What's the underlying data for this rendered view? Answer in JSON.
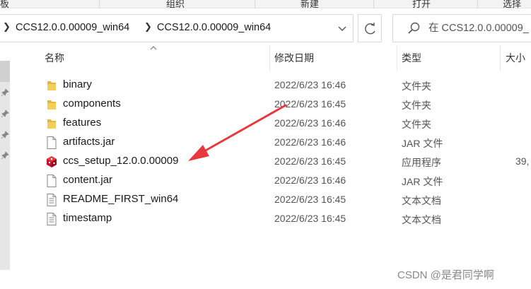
{
  "ribbon": {
    "items": [
      "板",
      "组织",
      "新建",
      "打开",
      "选择"
    ]
  },
  "address": {
    "crumbs": [
      "CCS12.0.0.00009_win64",
      "CCS12.0.0.00009_win64"
    ]
  },
  "search": {
    "placeholder": "在 CCS12.0.0.00009_"
  },
  "columns": {
    "name": "名称",
    "date": "修改日期",
    "type": "类型",
    "size": "大小"
  },
  "files": [
    {
      "name": "binary",
      "date": "2022/6/23 16:46",
      "type": "文件夹",
      "size": "",
      "icon": "folder-icon"
    },
    {
      "name": "components",
      "date": "2022/6/23 16:45",
      "type": "文件夹",
      "size": "",
      "icon": "folder-icon"
    },
    {
      "name": "features",
      "date": "2022/6/23 16:46",
      "type": "文件夹",
      "size": "",
      "icon": "folder-icon"
    },
    {
      "name": "artifacts.jar",
      "date": "2022/6/23 16:46",
      "type": "JAR 文件",
      "size": "",
      "icon": "file-icon"
    },
    {
      "name": "ccs_setup_12.0.0.00009",
      "date": "2022/6/23 16:45",
      "type": "应用程序",
      "size": "39,",
      "icon": "installer-icon"
    },
    {
      "name": "content.jar",
      "date": "2022/6/23 16:46",
      "type": "JAR 文件",
      "size": "",
      "icon": "file-icon"
    },
    {
      "name": "README_FIRST_win64",
      "date": "2022/6/23 16:45",
      "type": "文本文档",
      "size": "",
      "icon": "text-file-icon"
    },
    {
      "name": "timestamp",
      "date": "2022/6/23 16:45",
      "type": "文本文档",
      "size": "",
      "icon": "text-file-icon"
    }
  ],
  "watermark": "CSDN @是君同学啊",
  "colors": {
    "folder": "#f0c040",
    "arrow": "#e8383d",
    "installer": "#c8102e"
  }
}
